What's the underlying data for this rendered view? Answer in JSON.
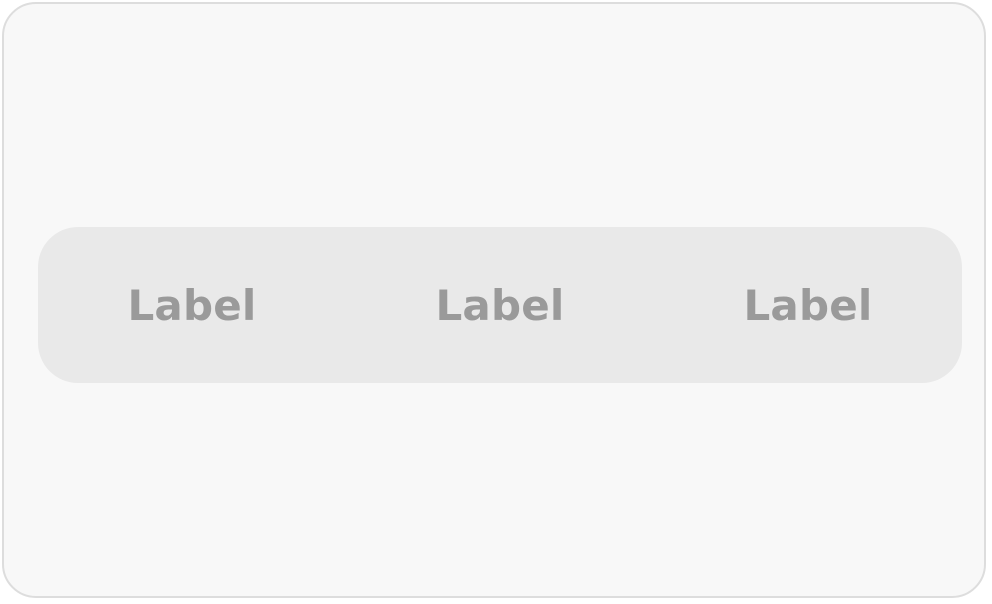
{
  "segmented_control": {
    "segments": [
      {
        "label": "Label"
      },
      {
        "label": "Label"
      },
      {
        "label": "Label"
      }
    ]
  },
  "colors": {
    "frame_background": "#f8f8f8",
    "frame_border": "#dddddd",
    "control_background": "#e9e9e9",
    "label_text": "#9a9a9a"
  }
}
